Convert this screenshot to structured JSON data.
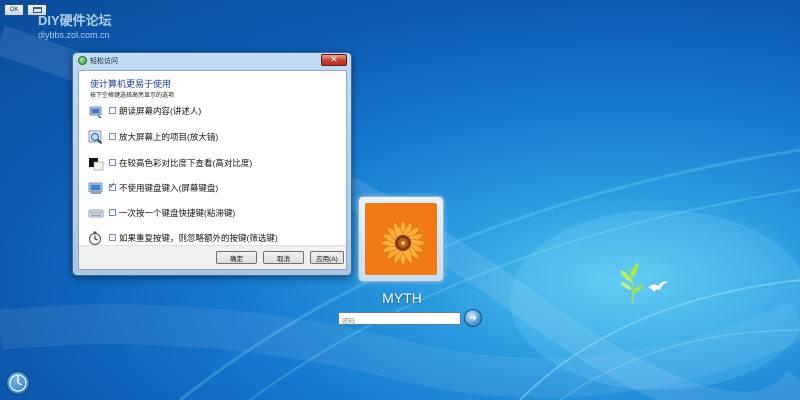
{
  "system": {
    "btn_left_label": "OK",
    "btn_right_label": ""
  },
  "watermark": {
    "title": "DIY硬件论坛",
    "url": "diybbs.zol.com.cn"
  },
  "dialog": {
    "title": "轻松访问",
    "close_label": "✕",
    "heading": "使计算机更易于使用",
    "subheading": "按下空格键选择高亮显示的选项",
    "options": [
      {
        "label": "朗读屏幕内容(讲述人)",
        "checked": false,
        "icon": "narrator-icon"
      },
      {
        "label": "放大屏幕上的项目(放大镜)",
        "checked": false,
        "icon": "magnifier-icon"
      },
      {
        "label": "在较高色彩对比度下查看(高对比度)",
        "checked": false,
        "icon": "high-contrast-icon"
      },
      {
        "label": "不使用键盘键入(屏幕键盘)",
        "checked": true,
        "icon": "onscreen-keyboard-icon"
      },
      {
        "label": "一次按一个键盘快捷键(粘滞键)",
        "checked": false,
        "icon": "sticky-keys-icon"
      },
      {
        "label": "如果重复按键，则忽略额外的按键(筛选键)",
        "checked": false,
        "icon": "filter-keys-icon"
      }
    ],
    "ok_label": "确定",
    "cancel_label": "取消",
    "apply_label": "应用(A)"
  },
  "login": {
    "username": "MYTH",
    "password_placeholder": "密码",
    "submit_icon": "arrow-right-icon"
  },
  "colors": {
    "background": "#1678cf",
    "accent": "#1e3e9c",
    "close": "#c7442d"
  }
}
